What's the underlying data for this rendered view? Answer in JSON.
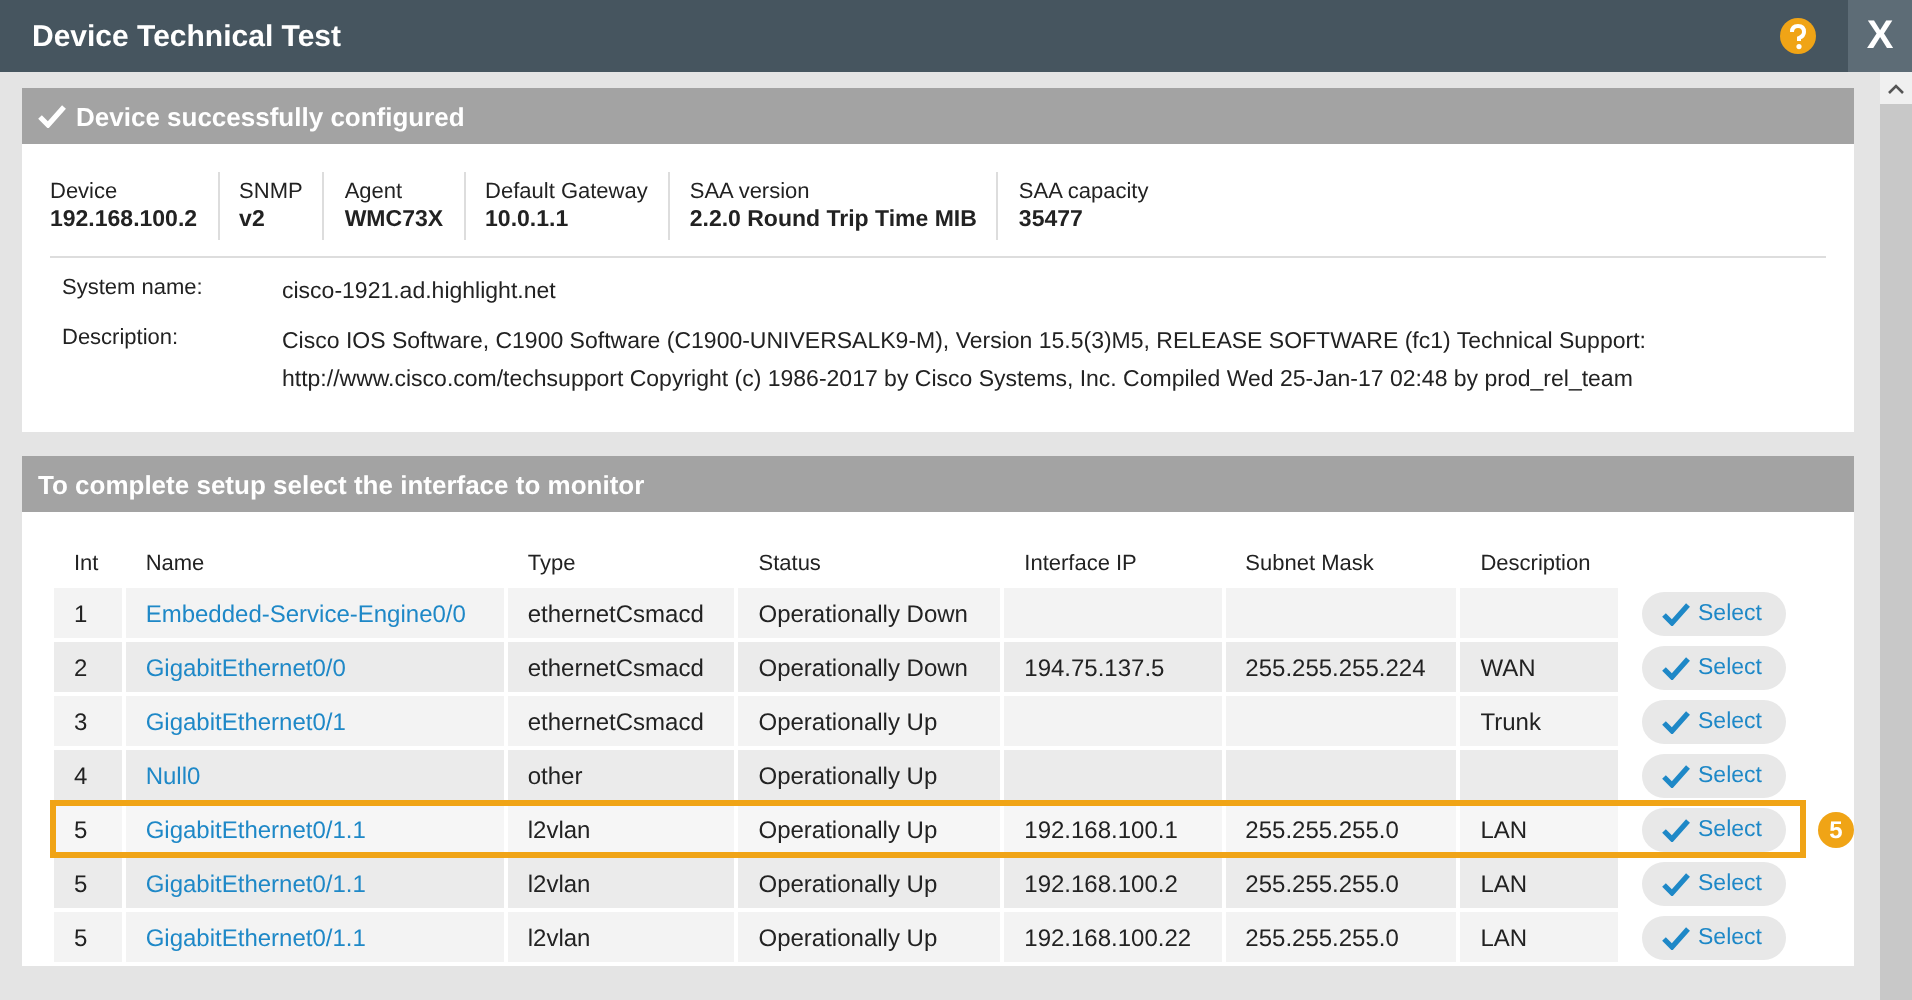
{
  "window": {
    "title": "Device Technical Test",
    "help_icon": true,
    "close_label": "X"
  },
  "status_panel": {
    "title": "Device successfully configured",
    "fields": [
      {
        "label": "Device",
        "value": "192.168.100.2"
      },
      {
        "label": "SNMP",
        "value": "v2"
      },
      {
        "label": "Agent",
        "value": "WMC73X"
      },
      {
        "label": "Default Gateway",
        "value": "10.0.1.1"
      },
      {
        "label": "SAA version",
        "value": "2.2.0 Round Trip Time MIB"
      },
      {
        "label": "SAA capacity",
        "value": "35477"
      }
    ],
    "details": [
      {
        "label": "System name:",
        "value": "cisco-1921.ad.highlight.net"
      },
      {
        "label": "Description:",
        "value": "Cisco IOS Software, C1900 Software (C1900-UNIVERSALK9-M), Version 15.5(3)M5, RELEASE SOFTWARE (fc1) Technical Support: http://www.cisco.com/techsupport Copyright (c) 1986-2017 by Cisco Systems, Inc. Compiled Wed 25-Jan-17 02:48 by prod_rel_team"
      }
    ]
  },
  "interface_panel": {
    "title": "To complete setup select the interface to monitor",
    "table": {
      "columns": [
        "Int",
        "Name",
        "Type",
        "Status",
        "Interface IP",
        "Subnet Mask",
        "Description"
      ],
      "rows": [
        {
          "int": "1",
          "name": "Embedded-Service-Engine0/0",
          "type": "ethernetCsmacd",
          "status": "Operationally Down",
          "ip": "",
          "mask": "",
          "description": "",
          "button": "Select",
          "highlighted": false
        },
        {
          "int": "2",
          "name": "GigabitEthernet0/0",
          "type": "ethernetCsmacd",
          "status": "Operationally Down",
          "ip": "194.75.137.5",
          "mask": "255.255.255.224",
          "description": "WAN",
          "button": "Select",
          "highlighted": false
        },
        {
          "int": "3",
          "name": "GigabitEthernet0/1",
          "type": "ethernetCsmacd",
          "status": "Operationally Up",
          "ip": "",
          "mask": "",
          "description": "Trunk",
          "button": "Select",
          "highlighted": false
        },
        {
          "int": "4",
          "name": "Null0",
          "type": "other",
          "status": "Operationally Up",
          "ip": "",
          "mask": "",
          "description": "",
          "button": "Select",
          "highlighted": false
        },
        {
          "int": "5",
          "name": "GigabitEthernet0/1.1",
          "type": "l2vlan",
          "status": "Operationally Up",
          "ip": "192.168.100.1",
          "mask": "255.255.255.0",
          "description": "LAN",
          "button": "Select",
          "highlighted": true,
          "callout": "5"
        },
        {
          "int": "5",
          "name": "GigabitEthernet0/1.1",
          "type": "l2vlan",
          "status": "Operationally Up",
          "ip": "192.168.100.2",
          "mask": "255.255.255.0",
          "description": "LAN",
          "button": "Select",
          "highlighted": false
        },
        {
          "int": "5",
          "name": "GigabitEthernet0/1.1",
          "type": "l2vlan",
          "status": "Operationally Up",
          "ip": "192.168.100.22",
          "mask": "255.255.255.0",
          "description": "LAN",
          "button": "Select",
          "highlighted": false
        }
      ]
    }
  }
}
